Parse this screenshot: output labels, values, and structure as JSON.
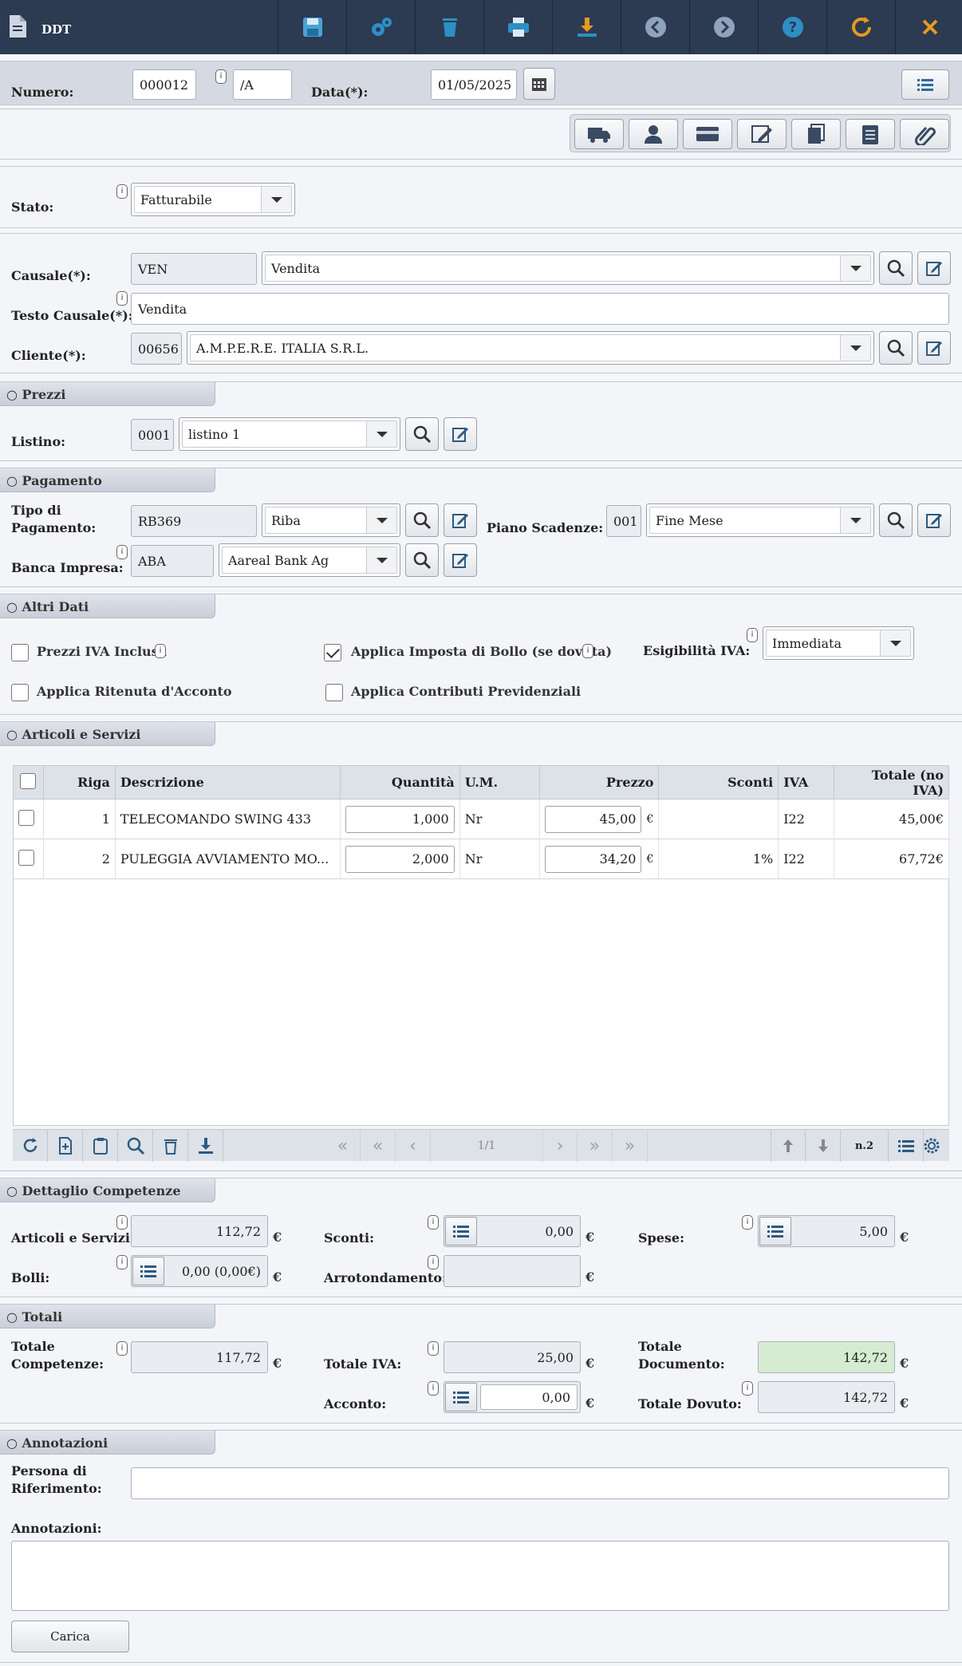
{
  "app": {
    "title": "DDT"
  },
  "header": {
    "numero_label": "Numero:",
    "numero": "000012",
    "suffix": "/A",
    "data_label": "Data(*):",
    "data": "01/05/2025"
  },
  "stato": {
    "label": "Stato:",
    "value": "Fatturabile"
  },
  "causale": {
    "label": "Causale(*):",
    "code": "VEN",
    "value": "Vendita"
  },
  "testo_causale": {
    "label": "Testo Causale(*):",
    "value": "Vendita"
  },
  "cliente": {
    "label": "Cliente(*):",
    "code": "00656",
    "value": "A.M.P.E.R.E. ITALIA S.R.L."
  },
  "prezzi": {
    "title": "○ Prezzi",
    "listino_label": "Listino:",
    "listino_code": "0001",
    "listino": "listino 1"
  },
  "pagamento": {
    "title": "○ Pagamento",
    "tipo_label_1": "Tipo di",
    "tipo_label_2": "Pagamento:",
    "tipo_code": "RB369",
    "tipo": "Riba",
    "piano_label": "Piano Scadenze:",
    "piano_code": "001",
    "piano": "Fine Mese",
    "banca_label": "Banca Impresa:",
    "banca_code": "ABA",
    "banca": "Aareal Bank Ag"
  },
  "altri": {
    "title": "○ Altri Dati",
    "prezzi_iva": "Prezzi IVA Inclusa",
    "bollo": "Applica Imposta di Bollo (se dovuta)",
    "esig_label": "Esigibilità IVA:",
    "esig": "Immediata",
    "ritenuta": "Applica Ritenuta d'Acconto",
    "contributi": "Applica Contributi Previdenziali"
  },
  "articoli": {
    "title": "○ Articoli e Servizi",
    "columns": [
      "Riga",
      "Descrizione",
      "Quantità",
      "U.M.",
      "Prezzo",
      "Sconti",
      "IVA",
      "Totale (no IVA)"
    ],
    "rows": [
      {
        "riga": "1",
        "descrizione": "TELECOMANDO SWING 433",
        "quantita": "1,000",
        "um": "Nr",
        "prezzo": "45,00",
        "valuta": "€",
        "sconti": "",
        "iva": "I22",
        "totale": "45,00€"
      },
      {
        "riga": "2",
        "descrizione": "PULEGGIA AVVIAMENTO MO...",
        "quantita": "2,000",
        "um": "Nr",
        "prezzo": "34,20",
        "valuta": "€",
        "sconti": "1%",
        "iva": "I22",
        "totale": "67,72€"
      }
    ],
    "page": "1/1",
    "count": "n.2"
  },
  "competenze": {
    "title": "○ Dettaglio Competenze",
    "art_label": "Articoli e Servizi:",
    "art": "112,72",
    "sconti_label": "Sconti:",
    "sconti": "0,00",
    "spese_label": "Spese:",
    "spese": "5,00",
    "bolli_label": "Bolli:",
    "bolli": "0,00 (0,00€)",
    "arr_label": "Arrotondamento:",
    "arr": "",
    "euro": "€"
  },
  "totali": {
    "title": "○ Totali",
    "comp_label_1": "Totale",
    "comp_label_2": "Competenze:",
    "comp": "117,72",
    "iva_label": "Totale IVA:",
    "iva": "25,00",
    "doc_label_1": "Totale",
    "doc_label_2": "Documento:",
    "doc": "142,72",
    "acconto_label": "Acconto:",
    "acconto": "0,00",
    "dovuto_label": "Totale Dovuto:",
    "dovuto": "142,72"
  },
  "annotazioni": {
    "title": "○ Annotazioni",
    "persona_label_1": "Persona di",
    "persona_label_2": "Riferimento:",
    "persona": "",
    "note_label": "Annotazioni:",
    "note": "",
    "carica": "Carica"
  },
  "info_glyph": "i",
  "colors": {
    "topbar": "#2c3a52",
    "icon_blue": "#2d8fc4",
    "icon_orange": "#e69a1c",
    "highlight": "#d5ecd2"
  }
}
